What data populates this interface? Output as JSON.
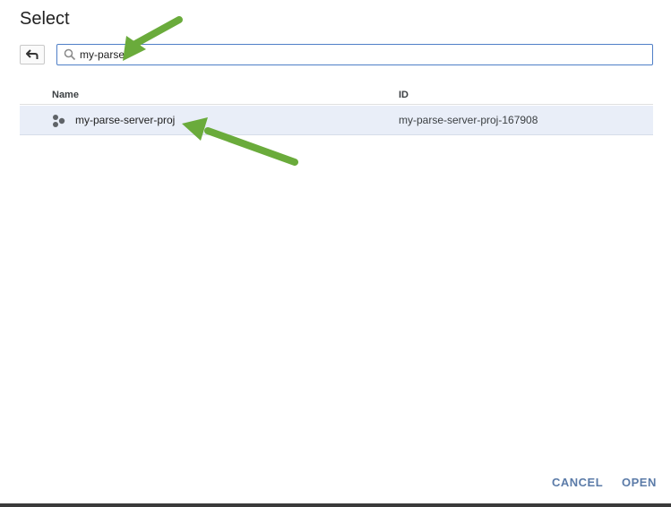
{
  "dialog": {
    "title": "Select",
    "accent_color": "#4f7fc7",
    "selected_row_color": "#e9eef8",
    "button_color": "#5b7ba8"
  },
  "toolbar": {
    "back_icon": "back-arrow-icon"
  },
  "search": {
    "icon": "search-icon",
    "value": "my-parse",
    "placeholder": ""
  },
  "table": {
    "columns": [
      "Name",
      "ID"
    ],
    "rows": [
      {
        "icon": "project-hexagon-icon",
        "name": "my-parse-server-proj",
        "id": "my-parse-server-proj-167908",
        "selected": true
      }
    ]
  },
  "footer": {
    "cancel_label": "CANCEL",
    "open_label": "OPEN"
  },
  "annotations": {
    "arrow_color": "#6aab3b",
    "arrows": [
      "arrow-to-search-input",
      "arrow-to-project-row"
    ]
  }
}
